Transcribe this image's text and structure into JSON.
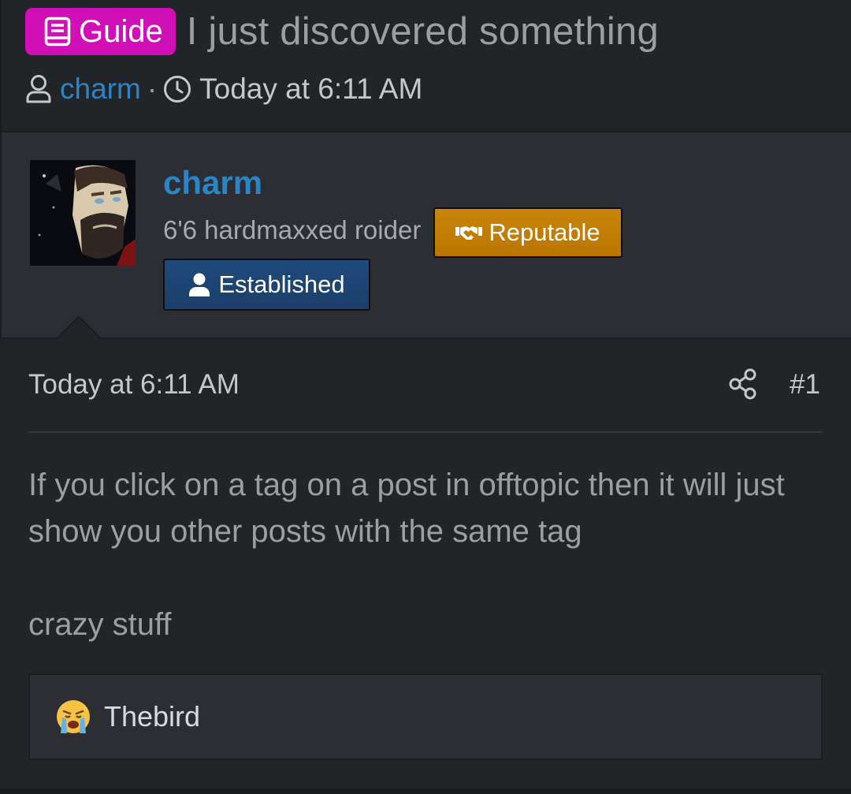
{
  "thread": {
    "prefix_label": "Guide",
    "prefix_color": "#d10fb6",
    "title": "I just discovered something",
    "author": "charm",
    "separator": "·",
    "date": "Today at 6:11 AM"
  },
  "user": {
    "username": "charm",
    "user_title": "6'6 hardmaxxed roider",
    "banners": [
      {
        "label": "Reputable",
        "icon": "handshake-icon",
        "color": "#c9840c"
      },
      {
        "label": "Established",
        "icon": "user-icon",
        "color": "#1f4a7c"
      }
    ]
  },
  "post": {
    "date": "Today at 6:11 AM",
    "number": "#1",
    "body_line_1": "If you click on a tag on a post in offtopic then it will just show you other posts with the same tag",
    "body_line_2": "crazy stuff"
  },
  "reactions": {
    "emoji": "crying-face-icon",
    "users": "Thebird"
  },
  "colors": {
    "link": "#2a85c7",
    "background": "#232428",
    "panel": "#2d2e33"
  }
}
